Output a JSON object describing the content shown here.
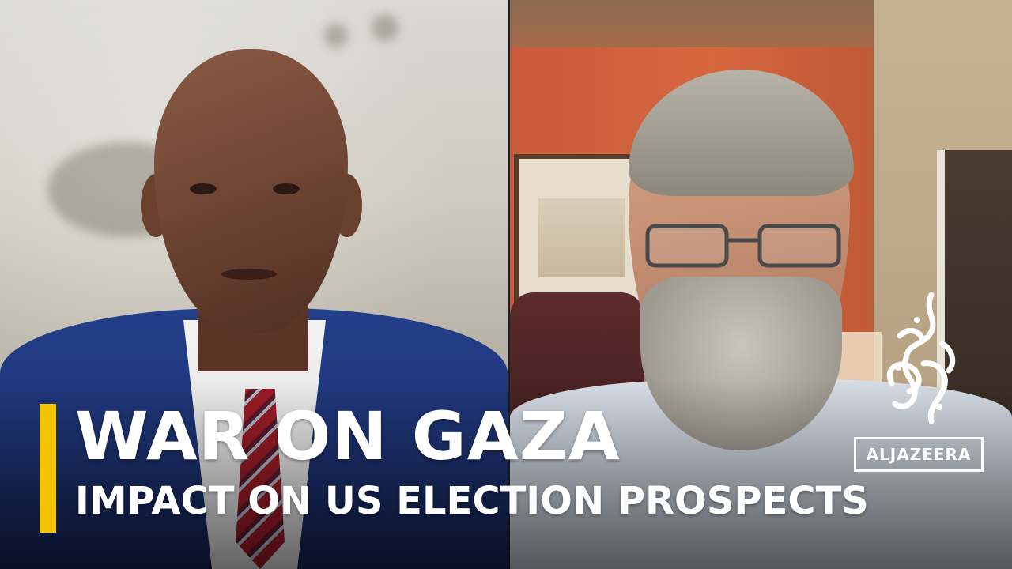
{
  "lower_third": {
    "headline": "WAR ON GAZA",
    "subheadline": "IMPACT ON US ELECTION PROSPECTS",
    "accent_color": "#f5c400"
  },
  "logo": {
    "wordmark": "ALJAZEERA",
    "icon": "aljazeera-calligraphy-logo-icon"
  },
  "panels": {
    "left": "studio-presenter-video",
    "right": "remote-guest-video"
  }
}
